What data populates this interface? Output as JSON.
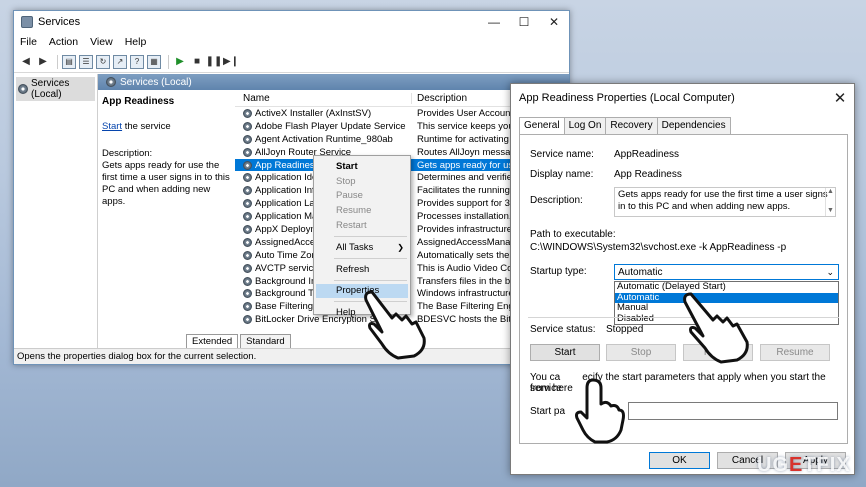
{
  "services_window": {
    "title": "Services",
    "menu": [
      "File",
      "Action",
      "View",
      "Help"
    ],
    "tree_item": "Services (Local)",
    "header": "Services (Local)",
    "desc_pane": {
      "title": "App Readiness",
      "start_link": "Start",
      "start_suffix": " the service",
      "description_label": "Description:",
      "description": "Gets apps ready for use the first time a user signs in to this PC and when adding new apps."
    },
    "columns": {
      "name": "Name",
      "description": "Description"
    },
    "rows": [
      {
        "name": "ActiveX Installer (AxInstSV)",
        "desc": "Provides User Account C"
      },
      {
        "name": "Adobe Flash Player Update Service",
        "desc": "This service keeps your"
      },
      {
        "name": "Agent Activation Runtime_980ab",
        "desc": "Runtime for activating c"
      },
      {
        "name": "AllJoyn Router Service",
        "desc": "Routes AllJoyn messages"
      },
      {
        "name": "App Readiness",
        "desc": "Gets apps ready for use t",
        "selected": true
      },
      {
        "name": "Application Ider",
        "desc": "Determines and verifies t"
      },
      {
        "name": "Application Info",
        "desc": "Facilitates the running of"
      },
      {
        "name": "Application Lay",
        "desc": "Provides support for 3rd"
      },
      {
        "name": "Application Ma",
        "desc": "Processes installation, re"
      },
      {
        "name": "AppX Deploym",
        "desc": "Provides infrastructure s"
      },
      {
        "name": "AssignedAccess",
        "desc": "AssignedAccessManager"
      },
      {
        "name": "Auto Time Zone",
        "desc": "Automatically sets the sy"
      },
      {
        "name": "AVCTP service",
        "desc": "This is Audio Video Cont"
      },
      {
        "name": "Background Int",
        "desc": "Transfers files in the back"
      },
      {
        "name": "Background Tas",
        "desc": "Windows infrastructure s"
      },
      {
        "name": "Base Filtering En",
        "desc": "The Base Filtering Engine"
      },
      {
        "name": "BitLocker Drive Encryption Service",
        "desc": "BDESVC hosts the BitLoc"
      }
    ],
    "tabs": [
      "Extended",
      "Standard"
    ],
    "status": "Opens the properties dialog box for the current selection."
  },
  "context_menu": {
    "items": [
      {
        "label": "Start",
        "disabled": false
      },
      {
        "label": "Stop",
        "disabled": true
      },
      {
        "label": "Pause",
        "disabled": true
      },
      {
        "label": "Resume",
        "disabled": true
      },
      {
        "label": "Restart",
        "disabled": true
      },
      {
        "label": "All Tasks",
        "disabled": false
      },
      {
        "label": "Refresh",
        "disabled": false
      },
      {
        "label": "Properties",
        "disabled": false
      },
      {
        "label": "Help",
        "disabled": false
      }
    ]
  },
  "dialog": {
    "title": "App Readiness Properties (Local Computer)",
    "tabs": [
      "General",
      "Log On",
      "Recovery",
      "Dependencies"
    ],
    "service_name_label": "Service name:",
    "service_name": "AppReadiness",
    "display_name_label": "Display name:",
    "display_name": "App Readiness",
    "description_label": "Description:",
    "description": "Gets apps ready for use the first time a user signs in to this PC and when adding new apps.",
    "path_label": "Path to executable:",
    "path": "C:\\WINDOWS\\System32\\svchost.exe -k AppReadiness -p",
    "startup_label": "Startup type:",
    "startup_value": "Automatic",
    "startup_options": [
      "Automatic (Delayed Start)",
      "Automatic",
      "Manual",
      "Disabled"
    ],
    "startup_highlighted_index": 1,
    "status_label": "Service status:",
    "status_value": "Stopped",
    "buttons": {
      "start": "Start",
      "stop": "Stop",
      "pause": "Pause",
      "resume": "Resume"
    },
    "hint_start": "You ca",
    "hint_end": "ecify the start parameters that apply when you start the service",
    "hint_line2": "from here",
    "params_label": "Start pa",
    "ok": "OK",
    "cancel": "Cancel",
    "apply": "Apply"
  },
  "watermark": {
    "left": "UG",
    "accent": "E",
    "right": "TFIX"
  }
}
